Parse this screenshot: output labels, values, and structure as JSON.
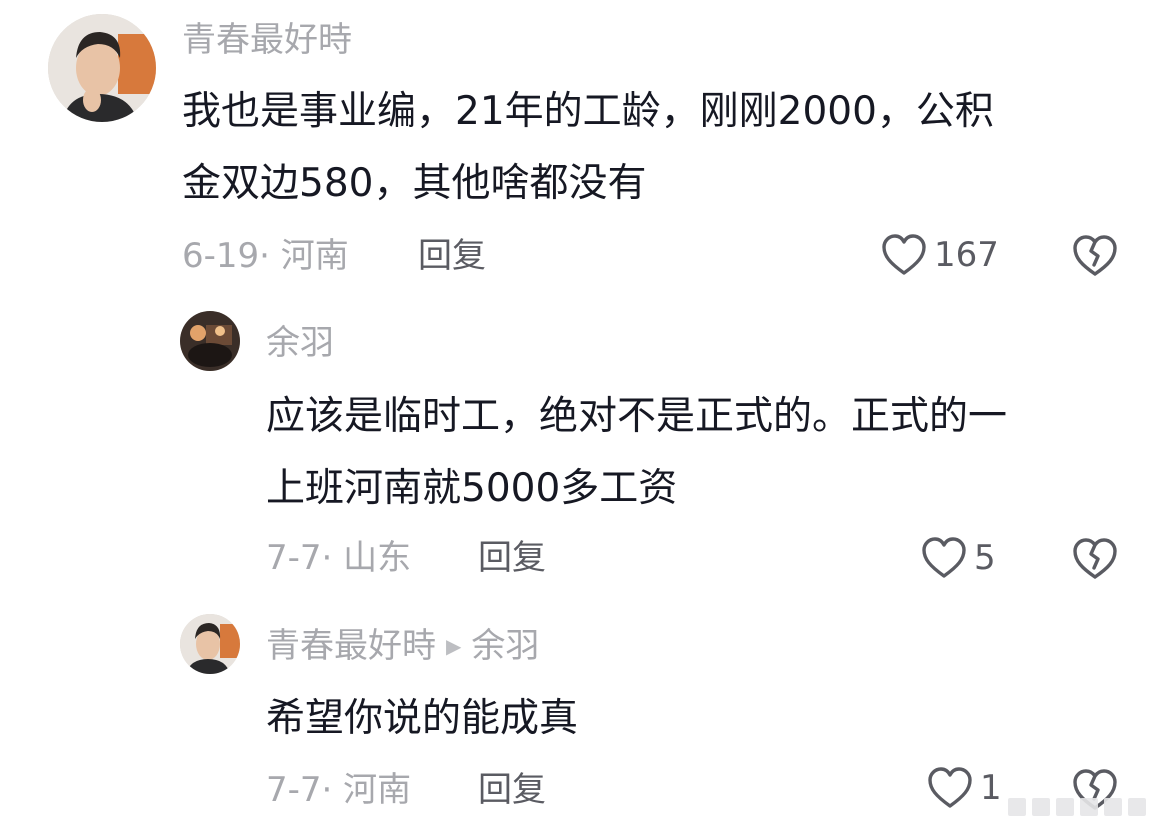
{
  "comments": [
    {
      "username": "青春最好時",
      "text": "我也是事业编，21年的工龄，刚刚2000，公积\n金双边580，其他啥都没有",
      "date_location": "6-19· 河南",
      "reply_label": "回复",
      "likes": "167"
    },
    {
      "username": "余羽",
      "text": "应该是临时工，绝对不是正式的。正式的一\n上班河南就5000多工资",
      "date_location": "7-7· 山东",
      "reply_label": "回复",
      "likes": "5"
    },
    {
      "username": "青春最好時",
      "reply_to": "余羽",
      "text": "希望你说的能成真",
      "date_location": "7-7· 河南",
      "reply_label": "回复",
      "likes": "1"
    }
  ],
  "icons": {
    "like": "heart-outline-icon",
    "dislike": "broken-heart-icon",
    "reply_arrow": "play-triangle-icon"
  },
  "colors": {
    "text": "#161823",
    "meta": "#a7a8ad",
    "action": "#5a5b62"
  }
}
